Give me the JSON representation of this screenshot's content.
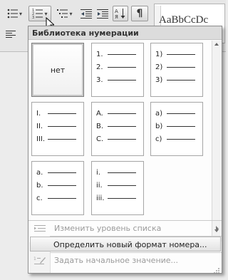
{
  "ribbon": {
    "styles_sample": "AaBbCcDc",
    "buttons": {
      "bullets": "bullets-icon",
      "numbering": "numbering-icon",
      "multilevel": "multilevel-list-icon",
      "decrease_indent": "decrease-indent-icon",
      "increase_indent": "increase-indent-icon",
      "sort": "sort-icon",
      "show_marks": "¶",
      "align_left": "align-left-icon"
    }
  },
  "menu": {
    "header": "Библиотека нумерации",
    "tiles": [
      {
        "name": "none",
        "label": "нет"
      },
      {
        "name": "arabic-period",
        "rows": [
          "1.",
          "2.",
          "3."
        ]
      },
      {
        "name": "arabic-paren",
        "rows": [
          "1)",
          "2)",
          "3)"
        ]
      },
      {
        "name": "roman-upper",
        "rows": [
          "I.",
          "II.",
          "III."
        ]
      },
      {
        "name": "alpha-upper",
        "rows": [
          "A.",
          "B.",
          "C."
        ]
      },
      {
        "name": "alpha-lower-paren",
        "rows": [
          "a)",
          "b)",
          "c)"
        ]
      },
      {
        "name": "alpha-lower-period",
        "rows": [
          "a.",
          "b.",
          "c."
        ]
      },
      {
        "name": "roman-lower",
        "rows": [
          "i.",
          "ii.",
          "iii."
        ]
      }
    ],
    "commands": {
      "change_level": "Изменить уровень списка",
      "define_new": "Определить новый формат номера...",
      "set_value": "Задать начальное значение..."
    }
  },
  "colors": {
    "menu_bg": "#fdfdfd",
    "header_bg": "#dcdcdc",
    "disabled_text": "#9a9a9a"
  }
}
